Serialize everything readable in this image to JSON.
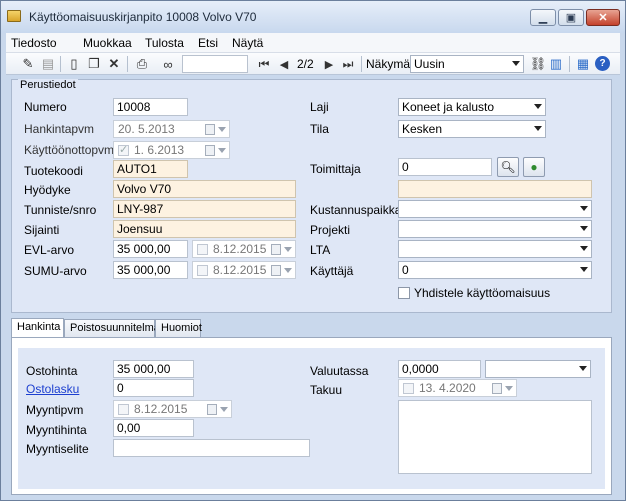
{
  "window": {
    "title": "Käyttöomaisuuskirjanpito 10008 Volvo V70"
  },
  "menu": {
    "items": [
      "Tiedosto",
      "Muokkaa",
      "Tulosta",
      "Etsi",
      "Näytä"
    ]
  },
  "toolbar": {
    "page_indicator": "2/2",
    "view_label": "Näkymä",
    "view_value": "Uusin",
    "icons": [
      "edit-icon",
      "save-icon",
      "new-icon",
      "copy-icon",
      "delete-icon",
      "print-icon",
      "binoculars-icon",
      "first-icon",
      "prev-icon",
      "next-icon",
      "last-icon",
      "link-icon",
      "database-icon",
      "layout-icon",
      "help-icon"
    ]
  },
  "basic": {
    "group_title": "Perustiedot",
    "numero_label": "Numero",
    "numero": "10008",
    "hankintapvm_label": "Hankintapvm",
    "hankintapvm": "20. 5.2013",
    "kayttoonottopvm_label": "Käyttöönottopvm",
    "kayttoonottopvm": "1. 6.2013",
    "tuotekoodi_label": "Tuotekoodi",
    "tuotekoodi": "AUTO1",
    "hyodyke_label": "Hyödyke",
    "hyodyke": "Volvo V70",
    "tunniste_label": "Tunniste/snro",
    "tunniste": "LNY-987",
    "sijainti_label": "Sijainti",
    "sijainti": "Joensuu",
    "evl_label": "EVL-arvo",
    "evl": "35 000,00",
    "evl_date": "8.12.2015",
    "sumu_label": "SUMU-arvo",
    "sumu": "35 000,00",
    "sumu_date": "8.12.2015",
    "laji_label": "Laji",
    "laji": "Koneet ja kalusto",
    "tila_label": "Tila",
    "tila": "Kesken",
    "toimittaja_label": "Toimittaja",
    "toimittaja": "0",
    "toimittaja_name": "",
    "kustannuspaikka_label": "Kustannuspaikka",
    "kustannuspaikka": "",
    "projekti_label": "Projekti",
    "projekti": "",
    "lta_label": "LTA",
    "lta": "",
    "kayttaja_label": "Käyttäjä",
    "kayttaja": "0",
    "yhdistele_label": "Yhdistele käyttöomaisuus"
  },
  "tabs": [
    "Hankinta",
    "Poistosuunnitelma",
    "Huomiot"
  ],
  "hankinta": {
    "ostohinta_label": "Ostohinta",
    "ostohinta": "35 000,00",
    "ostolasku_label": "Ostolasku",
    "ostolasku": "0",
    "myyntipvm_label": "Myyntipvm",
    "myyntipvm": "8.12.2015",
    "myyntihinta_label": "Myyntihinta",
    "myyntihinta": "0,00",
    "myyntiselite_label": "Myyntiselite",
    "myyntiselite": "",
    "valuutassa_label": "Valuutassa",
    "valuutassa": "0,0000",
    "valuutta": "",
    "takuu_label": "Takuu",
    "takuu": "13. 4.2020"
  }
}
